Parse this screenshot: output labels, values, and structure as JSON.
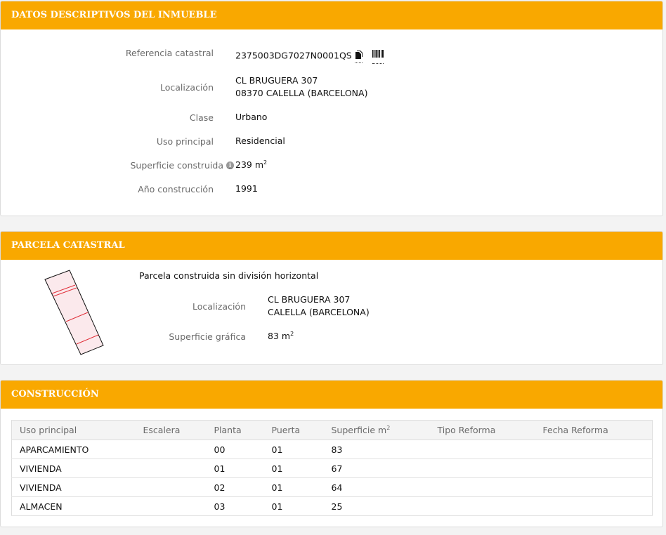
{
  "datos": {
    "title": "DATOS DESCRIPTIVOS DEL INMUEBLE",
    "referencia_label": "Referencia catastral",
    "referencia_value": "2375003DG7027N0001QS",
    "localizacion_label": "Localización",
    "localizacion_line1": "CL BRUGUERA 307",
    "localizacion_line2": "08370 CALELLA (BARCELONA)",
    "clase_label": "Clase",
    "clase_value": "Urbano",
    "uso_label": "Uso principal",
    "uso_value": "Residencial",
    "superficie_label": "Superficie construida",
    "superficie_value": "239 m",
    "superficie_unit_exp": "2",
    "anio_label": "Año construcción",
    "anio_value": "1991"
  },
  "parcela": {
    "title": "PARCELA CATASTRAL",
    "descripcion": "Parcela construida sin división horizontal",
    "localizacion_label": "Localización",
    "localizacion_line1": "CL BRUGUERA 307",
    "localizacion_line2": "CALELLA (BARCELONA)",
    "superficie_label": "Superficie gráfica",
    "superficie_value": "83 m",
    "superficie_unit_exp": "2"
  },
  "construccion": {
    "title": "CONSTRUCCIÓN",
    "columns": [
      "Uso principal",
      "Escalera",
      "Planta",
      "Puerta",
      "Superficie m",
      "Tipo Reforma",
      "Fecha Reforma"
    ],
    "superficie_exp": "2",
    "rows": [
      [
        "APARCAMIENTO",
        "",
        "00",
        "01",
        "83",
        "",
        ""
      ],
      [
        "VIVIENDA",
        "",
        "01",
        "01",
        "67",
        "",
        ""
      ],
      [
        "VIVIENDA",
        "",
        "02",
        "01",
        "64",
        "",
        ""
      ],
      [
        "ALMACEN",
        "",
        "03",
        "01",
        "25",
        "",
        ""
      ]
    ]
  },
  "colors": {
    "header_orange": "#f9a800",
    "parcel_line_red": "#e0303a"
  }
}
